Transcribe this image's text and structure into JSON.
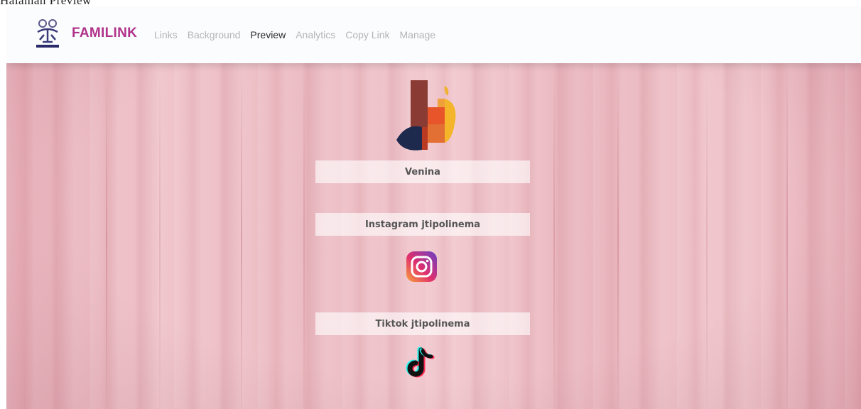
{
  "page_heading": "Halaman Preview",
  "navbar": {
    "brand": "FAMILINK",
    "links": [
      {
        "label": "Links",
        "active": false
      },
      {
        "label": "Background",
        "active": false
      },
      {
        "label": "Preview",
        "active": true
      },
      {
        "label": "Analytics",
        "active": false
      },
      {
        "label": "Copy Link",
        "active": false
      },
      {
        "label": "Manage",
        "active": false
      }
    ]
  },
  "profile": {
    "name": "Venina",
    "links": [
      {
        "label": "Instagram jtipolinema",
        "icon": "instagram-icon"
      },
      {
        "label": "Tiktok jtipolinema",
        "icon": "tiktok-icon"
      }
    ]
  },
  "colors": {
    "brand": "#b0338b",
    "nav_active": "#2a2a2a",
    "nav_inactive": "#b5b5b5",
    "background": "#ebbac1"
  }
}
